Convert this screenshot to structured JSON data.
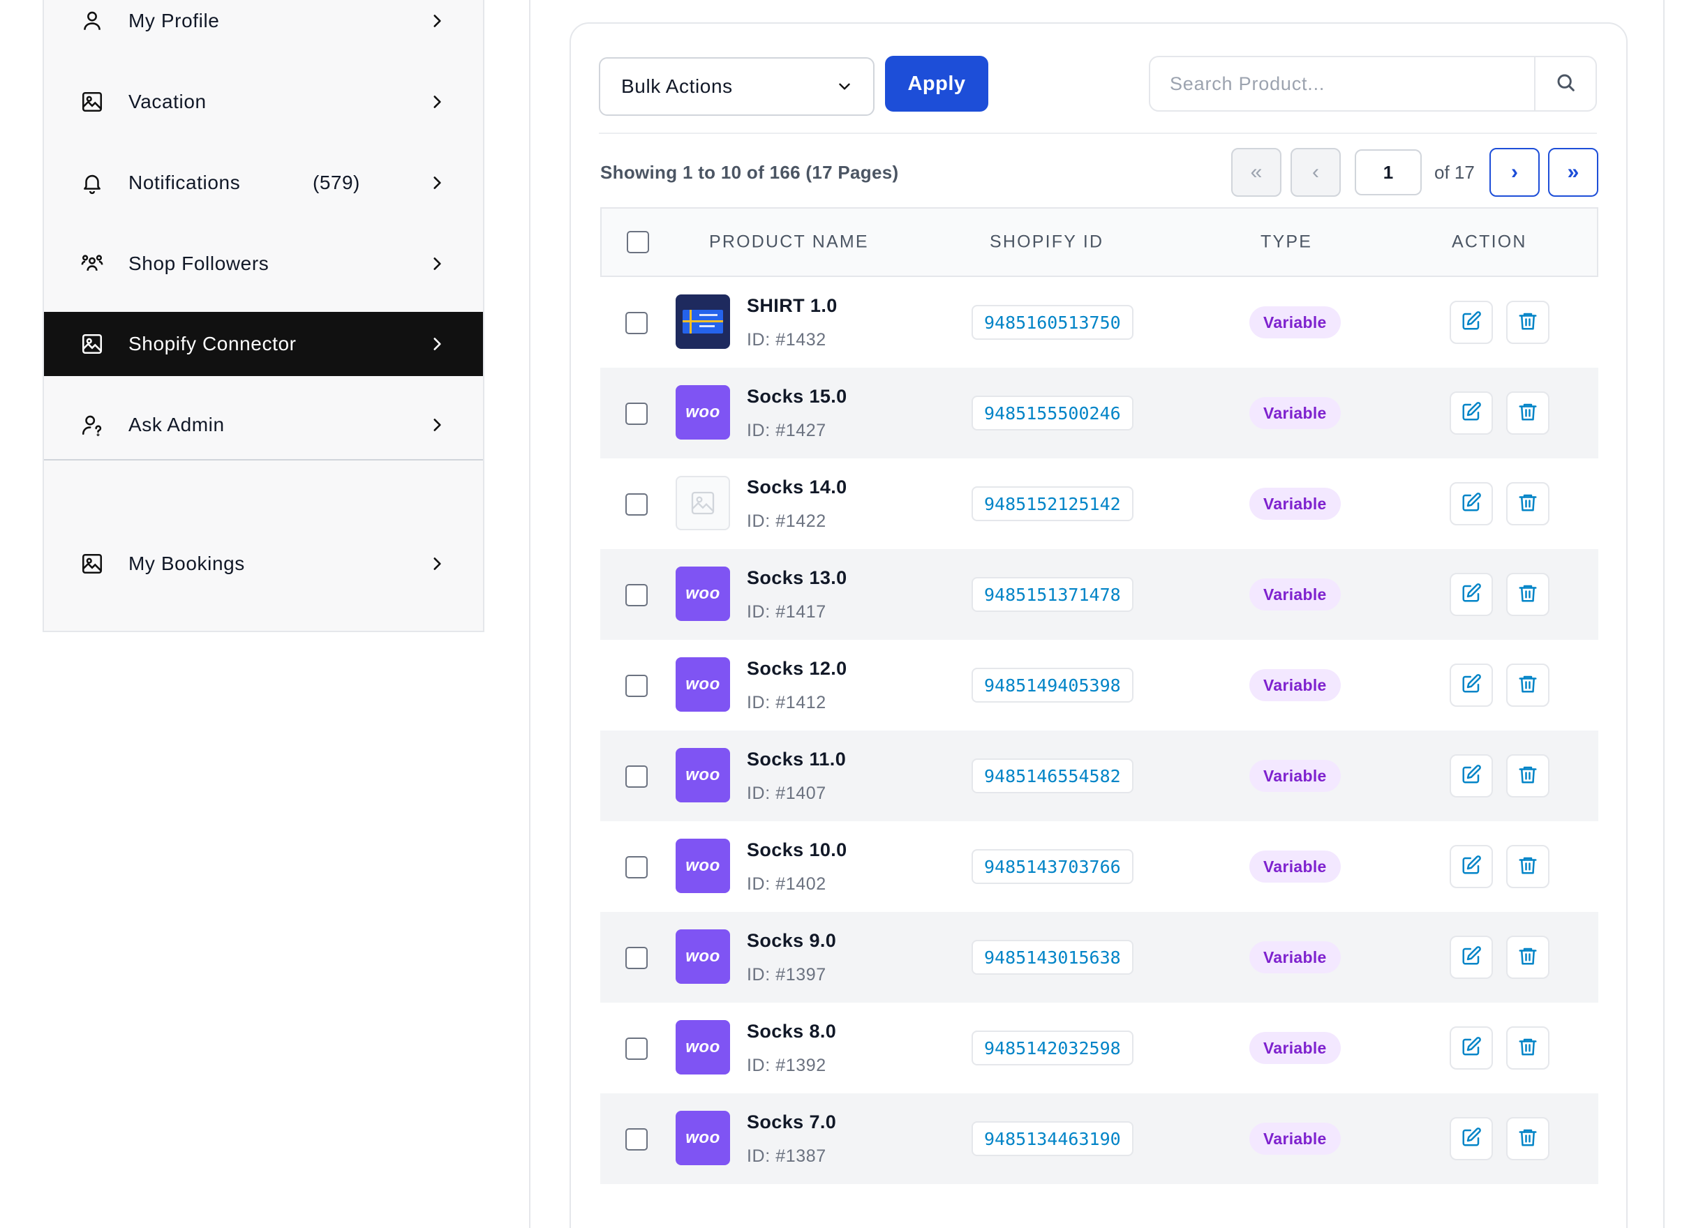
{
  "sidebar": {
    "items": [
      {
        "label": "My Profile",
        "icon": "user-icon"
      },
      {
        "label": "Vacation",
        "icon": "image-icon"
      },
      {
        "label": "Notifications",
        "count": "(579)",
        "icon": "bell-icon"
      },
      {
        "label": "Shop Followers",
        "icon": "users-icon"
      },
      {
        "label": "Shopify Connector",
        "icon": "image-icon",
        "active": true
      },
      {
        "label": "Ask Admin",
        "icon": "user-question-icon"
      },
      {
        "label": "My Bookings",
        "icon": "image-icon"
      }
    ]
  },
  "toolbar": {
    "bulk_actions": "Bulk Actions",
    "apply": "Apply",
    "search_placeholder": "Search Product..."
  },
  "pagination": {
    "showing": "Showing 1 to 10 of 166 (17 Pages)",
    "first": "«",
    "prev": "‹",
    "current": "1",
    "of": "of 17",
    "next": "›",
    "last": "»"
  },
  "table": {
    "headers": {
      "name": "PRODUCT NAME",
      "shopify_id": "SHOPIFY ID",
      "type": "TYPE",
      "action": "ACTION"
    },
    "rows": [
      {
        "name": "SHIRT 1.0",
        "id": "ID: #1432",
        "shopify_id": "9485160513750",
        "type": "Variable",
        "thumb": "shirt"
      },
      {
        "name": "Socks 15.0",
        "id": "ID: #1427",
        "shopify_id": "9485155500246",
        "type": "Variable",
        "thumb": "woo"
      },
      {
        "name": "Socks 14.0",
        "id": "ID: #1422",
        "shopify_id": "9485152125142",
        "type": "Variable",
        "thumb": "blank"
      },
      {
        "name": "Socks 13.0",
        "id": "ID: #1417",
        "shopify_id": "9485151371478",
        "type": "Variable",
        "thumb": "woo"
      },
      {
        "name": "Socks 12.0",
        "id": "ID: #1412",
        "shopify_id": "9485149405398",
        "type": "Variable",
        "thumb": "woo"
      },
      {
        "name": "Socks 11.0",
        "id": "ID: #1407",
        "shopify_id": "9485146554582",
        "type": "Variable",
        "thumb": "woo"
      },
      {
        "name": "Socks 10.0",
        "id": "ID: #1402",
        "shopify_id": "9485143703766",
        "type": "Variable",
        "thumb": "woo"
      },
      {
        "name": "Socks 9.0",
        "id": "ID: #1397",
        "shopify_id": "9485143015638",
        "type": "Variable",
        "thumb": "woo"
      },
      {
        "name": "Socks 8.0",
        "id": "ID: #1392",
        "shopify_id": "9485142032598",
        "type": "Variable",
        "thumb": "woo"
      },
      {
        "name": "Socks 7.0",
        "id": "ID: #1387",
        "shopify_id": "9485134463190",
        "type": "Variable",
        "thumb": "woo"
      }
    ]
  },
  "woo_label": "woo",
  "colors": {
    "accent": "#1d4ed8",
    "active_nav": "#111111",
    "woo": "#7f54f3",
    "badge_bg": "#f3e8ff",
    "badge_text": "#7e22ce",
    "id_text": "#0284c7"
  }
}
